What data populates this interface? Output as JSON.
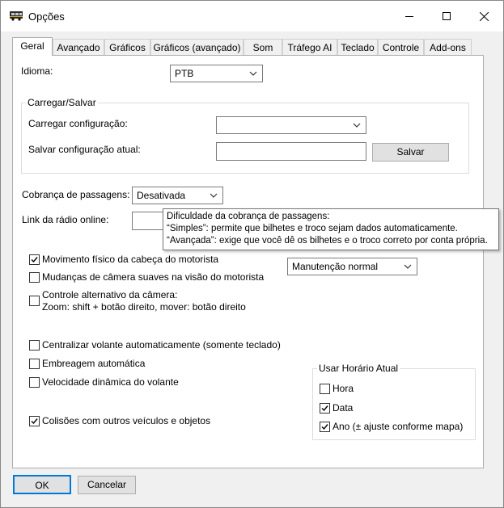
{
  "window": {
    "title": "Opções",
    "minimize": "minimize",
    "maximize": "maximize",
    "close": "close"
  },
  "tabs": [
    "Geral",
    "Avançado",
    "Gráficos",
    "Gráficos (avançado)",
    "Som",
    "Tráfego AI",
    "Teclado",
    "Controle",
    "Add-ons"
  ],
  "language": {
    "label": "Idioma:",
    "value": "PTB"
  },
  "load_save": {
    "group_label": "Carregar/Salvar",
    "load_label": "Carregar configuração:",
    "load_value": "",
    "save_label": "Salvar configuração atual:",
    "save_value": "",
    "save_button": "Salvar"
  },
  "fare": {
    "label": "Cobrança de passagens:",
    "value": "Desativada"
  },
  "radio": {
    "label": "Link da rádio online:",
    "value": ""
  },
  "tooltip": {
    "line1": "Dificuldade da cobrança de passagens:",
    "line2": "“Simples”: permite que bilhetes e troco sejam dados automaticamente.",
    "line3": "“Avançada”: exige que você dê os bilhetes e o troco correto por conta própria."
  },
  "maintenance": {
    "value": "Manutenção normal"
  },
  "checkboxes": {
    "head_movement": {
      "label": "Movimento físico da cabeça do motorista",
      "checked": true
    },
    "smooth_camera": {
      "label": "Mudanças de câmera suaves na visão do motorista",
      "checked": false
    },
    "alt_camera": {
      "label1": "Controle alternativo da câmera:",
      "label2": "Zoom: shift + botão direito, mover: botão direito",
      "checked": false
    },
    "center_wheel": {
      "label": "Centralizar volante automaticamente (somente teclado)",
      "checked": false
    },
    "auto_clutch": {
      "label": "Embreagem automática",
      "checked": false
    },
    "dynamic_wheel": {
      "label": "Velocidade dinâmica do volante",
      "checked": false
    },
    "collisions": {
      "label": "Colisões com outros veículos e objetos",
      "checked": true
    }
  },
  "current_time": {
    "group_label": "Usar Horário Atual",
    "hour": {
      "label": "Hora",
      "checked": false
    },
    "date": {
      "label": "Data",
      "checked": true
    },
    "year": {
      "label": "Ano (± ajuste conforme mapa)",
      "checked": true
    }
  },
  "footer": {
    "ok": "OK",
    "cancel": "Cancelar"
  }
}
